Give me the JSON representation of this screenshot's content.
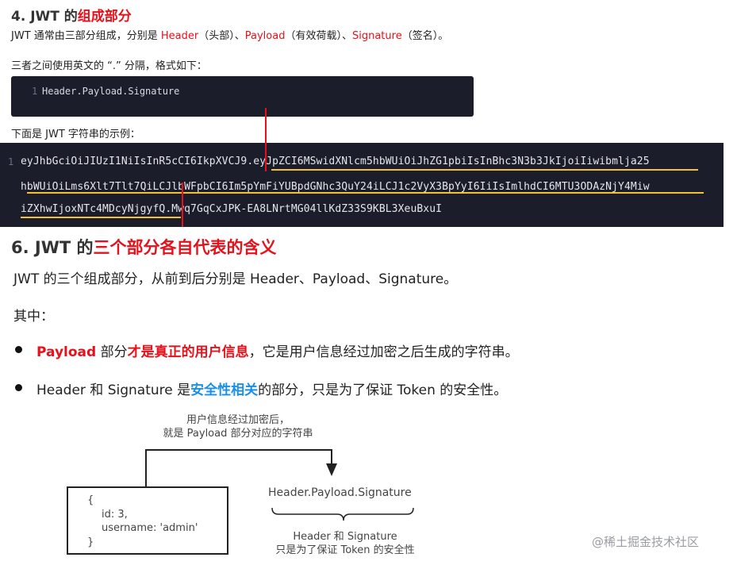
{
  "section4": {
    "title_prefix": "4. JWT 的",
    "title_highlight": "组成部分",
    "desc_prefix": "JWT 通常由三部分组成，分别是 ",
    "desc_header": "Header",
    "desc_header_cn": "（头部）、",
    "desc_payload": "Payload",
    "desc_payload_cn": "（有效荷载）、",
    "desc_signature": "Signature",
    "desc_signature_cn": "（签名）。",
    "separator_text": "三者之间使用英文的 “.” 分隔，格式如下：",
    "format_code": {
      "line_no": "1",
      "text": "Header.Payload.Signature"
    },
    "example_label": "下面是 JWT 字符串的示例：",
    "example_code": {
      "line_no": "1",
      "lines": [
        "eyJhbGciOiJIUzI1NiIsInR5cCI6IkpXVCJ9.eyJpZCI6MSwidXNlcm5hbWUiOiJhZG1pbiIsInBhc3N3b3JkIjoiIiwibmlja25",
        "hbWUiOiLms6Xlt7Tlt7QiLCJlbWFpbCI6Im5pYmFiYUBpdGNhc3QuY24iLCJ1c2VyX3BpYyI6IiIsImlhdCI6MTU3ODAzNjY4Miw",
        "iZXhwIjoxNTc4MDcyNjgyfQ.Mwq7GqCxJPK-EA8LNrtMG04llKdZ33S9KBL3XeuBxuI"
      ]
    }
  },
  "section6": {
    "title_prefix": "6. JWT 的",
    "title_highlight": "三个部分各自代表的含义",
    "desc": "JWT 的三个组成部分，从前到后分别是 Header、Payload、Signature。",
    "among": "其中：",
    "bullets": [
      {
        "term": "Payload",
        "mid": " 部分",
        "highlight": "才是真正的用户信息",
        "rest": "，它是用户信息经过加密之后生成的字符串。"
      },
      {
        "term": "Header 和 Signature 是",
        "highlight": "安全性相关",
        "rest": "的部分，只是为了保证 Token 的安全性。"
      }
    ]
  },
  "diagram": {
    "caption_top": [
      "用户信息经过加密后，",
      "就是 Payload 部分对应的字符串"
    ],
    "object_lines": [
      "{",
      "id: 3,",
      "username: 'admin'",
      "}"
    ],
    "signature_text": "Header.Payload.Signature",
    "caption_bottom": [
      "Header 和 Signature",
      "只是为了保证 Token 的安全性"
    ]
  },
  "watermark": "@稀土掘金技术社区",
  "colors": {
    "accent_red": "#e8101a",
    "accent_blue": "#1a8fe8",
    "code_bg": "#1b1d2a",
    "underline_yellow": "#f2c230"
  }
}
